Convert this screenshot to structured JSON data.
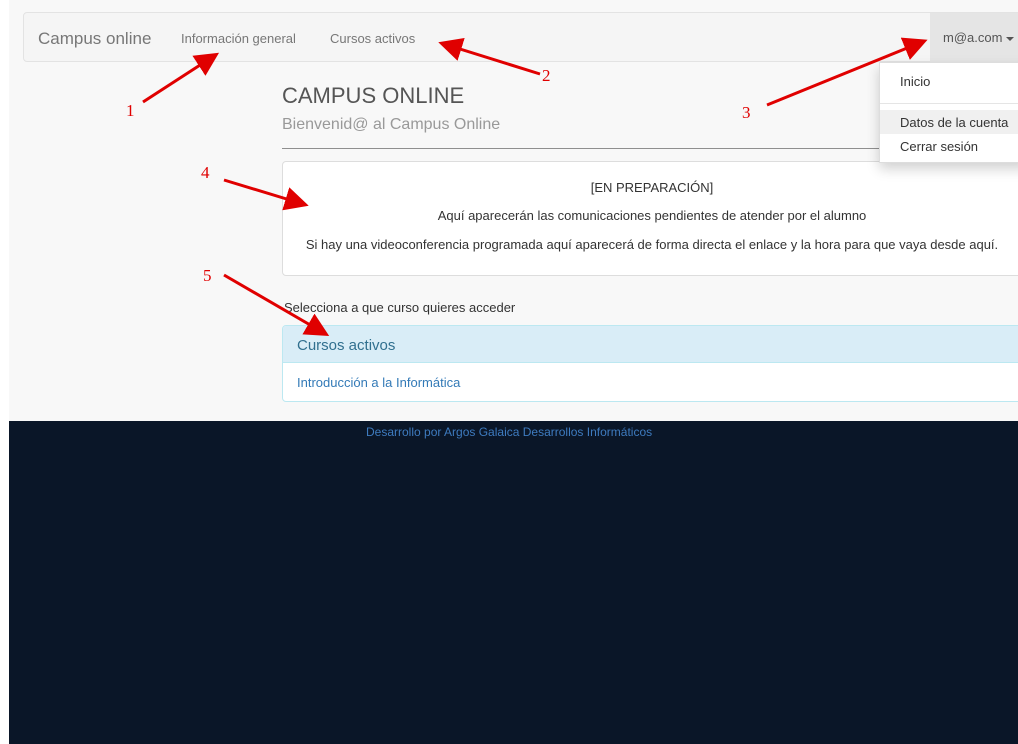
{
  "navbar": {
    "brand": "Campus online",
    "links": [
      "Información general",
      "Cursos activos"
    ],
    "user": "m@a.com"
  },
  "user_menu": {
    "items": [
      "Inicio",
      "Datos de la cuenta",
      "Cerrar sesión"
    ]
  },
  "header": {
    "title": "CAMPUS ONLINE",
    "subtitle": "Bienvenid@ al Campus Online"
  },
  "info_panel": {
    "lines": [
      "[EN PREPARACIÓN]",
      "Aquí aparecerán las comunicaciones pendientes de atender por el alumno",
      "Si hay una videoconferencia programada aquí aparecerá de forma directa el enlace y la hora para que vaya desde aquí."
    ]
  },
  "courses": {
    "instruction": "Selecciona a que curso quieres acceder",
    "heading": "Cursos activos",
    "items": [
      "Introducción a la Informática"
    ]
  },
  "footer": {
    "text": "Desarrollo por Argos Galaica Desarrollos Informáticos"
  },
  "annotations": {
    "color": "#e00000",
    "labels": [
      "1",
      "2",
      "3",
      "4",
      "5"
    ]
  }
}
